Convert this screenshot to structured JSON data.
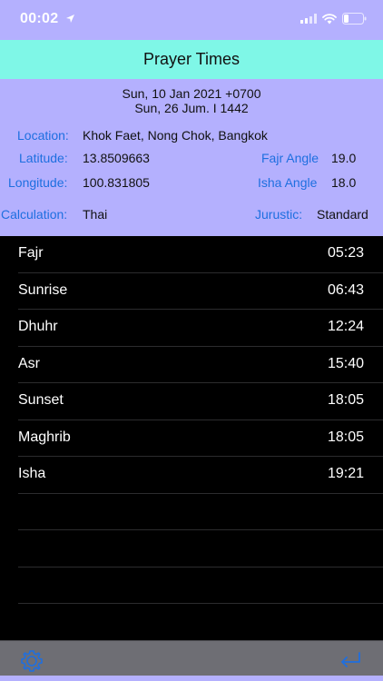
{
  "status": {
    "time": "00:02"
  },
  "header": {
    "title": "Prayer Times"
  },
  "info": {
    "gregorian_date": "Sun, 10 Jan 2021 +0700",
    "hijri_date": "Sun, 26 Jum. I 1442",
    "location_label": "Location:",
    "location_value": "Khok Faet, Nong Chok, Bangkok",
    "latitude_label": "Latitude:",
    "latitude_value": "13.8509663",
    "fajr_angle_label": "Fajr Angle",
    "fajr_angle_value": "19.0",
    "longitude_label": "Longitude:",
    "longitude_value": "100.831805",
    "isha_angle_label": "Isha Angle",
    "isha_angle_value": "18.0",
    "calculation_label": "Calculation:",
    "calculation_value": "Thai",
    "juristic_label": "Jurustic:",
    "juristic_value": "Standard"
  },
  "prayers": [
    {
      "name": "Fajr",
      "time": "05:23"
    },
    {
      "name": "Sunrise",
      "time": "06:43"
    },
    {
      "name": "Dhuhr",
      "time": "12:24"
    },
    {
      "name": "Asr",
      "time": "15:40"
    },
    {
      "name": "Sunset",
      "time": "18:05"
    },
    {
      "name": "Maghrib",
      "time": "18:05"
    },
    {
      "name": "Isha",
      "time": "19:21"
    }
  ],
  "toolbar": {
    "settings_icon": "gear-icon",
    "back_icon": "return-arrow-icon",
    "accent_color": "#1e6fe0"
  }
}
